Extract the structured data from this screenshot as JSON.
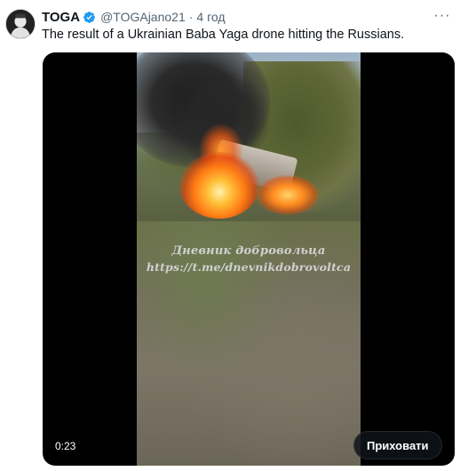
{
  "tweet": {
    "author_name": "TOGA",
    "author_handle": "@TOGAjano21",
    "separator": "·",
    "time": "4 год",
    "text": "The result of a Ukrainian Baba Yaga drone hitting the Russians.",
    "verified": true
  },
  "media": {
    "watermark_line1": "Дневник добровольца",
    "watermark_line2": "https://t.me/dnevnikdobrovoltca",
    "timecode": "0:23",
    "hide_label": "Приховати"
  },
  "colors": {
    "verified_badge": "#1d9bf0",
    "text_primary": "#0f1419",
    "text_secondary": "#536471",
    "media_background": "#000000"
  },
  "icons": {
    "verified": "verified-badge-icon",
    "more": "more-icon"
  }
}
